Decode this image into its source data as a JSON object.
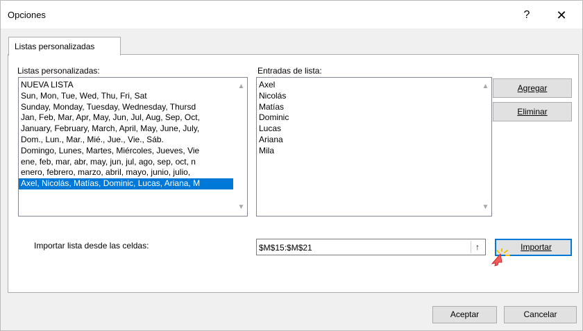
{
  "window": {
    "title": "Opciones",
    "help_label": "?",
    "close_label": "✕"
  },
  "tab": {
    "label": "Listas personalizadas"
  },
  "lists": {
    "label": "Listas personalizadas:",
    "items": [
      "NUEVA LISTA",
      "Sun, Mon, Tue, Wed, Thu, Fri, Sat",
      "Sunday, Monday, Tuesday, Wednesday, Thursd",
      "Jan, Feb, Mar, Apr, May, Jun, Jul, Aug, Sep, Oct,",
      "January, February, March, April, May, June, July,",
      "Dom., Lun., Mar., Mié., Jue., Vie., Sáb.",
      "Domingo, Lunes, Martes, Miércoles, Jueves, Vie",
      "ene, feb, mar, abr, may, jun, jul, ago, sep, oct, n",
      "enero, febrero, marzo, abril, mayo, junio, julio,",
      "Axel, Nicolás, Matías, Dominic, Lucas, Ariana, M"
    ],
    "selected_index": 9
  },
  "entries": {
    "label": "Entradas de lista:",
    "items": [
      "Axel",
      "Nicolás",
      "Matías",
      "Dominic",
      "Lucas",
      "Ariana",
      "Mila"
    ]
  },
  "buttons": {
    "agregar": "Agregar",
    "eliminar": "Eliminar",
    "importar": "Importar",
    "aceptar": "Aceptar",
    "cancelar": "Cancelar"
  },
  "import": {
    "label": "Importar lista desde las celdas:",
    "value": "$M$15:$M$21",
    "collapse_icon": "↑"
  },
  "colors": {
    "selection": "#0078d7",
    "button_face": "#e1e1e1",
    "dialog_bg": "#f0f0f0"
  }
}
